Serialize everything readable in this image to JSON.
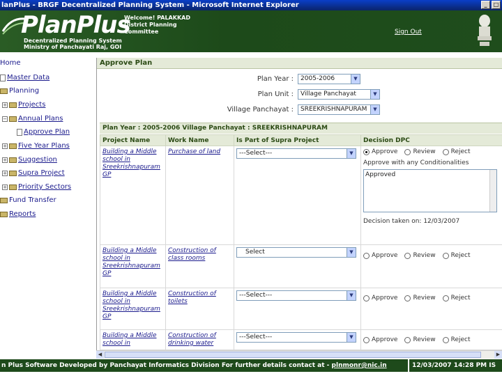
{
  "window": {
    "title": "lanPlus - BRGF Decentralized Planning System - Microsoft Internet Explorer"
  },
  "header": {
    "logo_text": "PlanPlus",
    "logo_sub_line1": "Decentralized Planning System",
    "logo_sub_line2": "Ministry of Panchayati Raj, GOI",
    "welcome_line1": "Welcome! PALAKKAD",
    "welcome_line2": "District Planning",
    "welcome_line3": "Committee",
    "sign_out": "Sign Out"
  },
  "nav": {
    "home": "Home",
    "master_data": "Master Data",
    "planning": "Planning",
    "projects": "Projects",
    "annual_plans": "Annual Plans",
    "approve_plan": "Approve Plan",
    "five_year_plans": "Five Year Plans",
    "suggestion": "Suggestion",
    "supra_project": "Supra Project",
    "priority_sectors": "Priority Sectors",
    "fund_transfer": "Fund Transfer",
    "reports": "Reports"
  },
  "panel": {
    "title": "Approve Plan",
    "plan_year_label": "Plan Year :",
    "plan_year_value": "2005-2006",
    "plan_unit_label": "Plan Unit :",
    "plan_unit_value": "Village Panchayat",
    "village_label": "Village Panchayat :",
    "village_value": "SREEKRISHNAPURAM",
    "plan_bar": "Plan Year : 2005-2006   Village Panchayat : SREEKRISHNAPURAM"
  },
  "table": {
    "headers": [
      "Project Name",
      "Work Name",
      "Is Part of Supra Project",
      "Decision DPC"
    ],
    "radio_labels": [
      "Approve",
      "Review",
      "Reject"
    ],
    "conditional_label": "Approve with any Conditionalities",
    "textarea_value": "Approved",
    "decision_taken": "Decision taken on: 12/03/2007",
    "rows": [
      {
        "project": "Building a Middle school in Sreekrishnapuram GP",
        "work": "Purchase of land",
        "supra": "---Select---",
        "selected": "Approve"
      },
      {
        "project": "Building a Middle school in Sreekrishnapuram GP",
        "work": "Construction of class rooms",
        "supra": "Select",
        "selected": ""
      },
      {
        "project": "Building a Middle school in Sreekrishnapuram GP",
        "work": "Construction of toilets",
        "supra": "---Select---",
        "selected": ""
      },
      {
        "project": "Building a Middle school in",
        "work": "Construction of drinking water",
        "supra": "---Select---",
        "selected": ""
      }
    ]
  },
  "footer": {
    "text": "n Plus Software Developed by Panchayat Informatics Division For further details contact at - ",
    "email": "plnmonr@nic.in",
    "datetime": "12/03/2007 14:28 PM IS"
  },
  "colors": {
    "header_green": "#1e4a1b",
    "panel_header": "#e4ead8",
    "link_blue": "#1a1a8c"
  }
}
